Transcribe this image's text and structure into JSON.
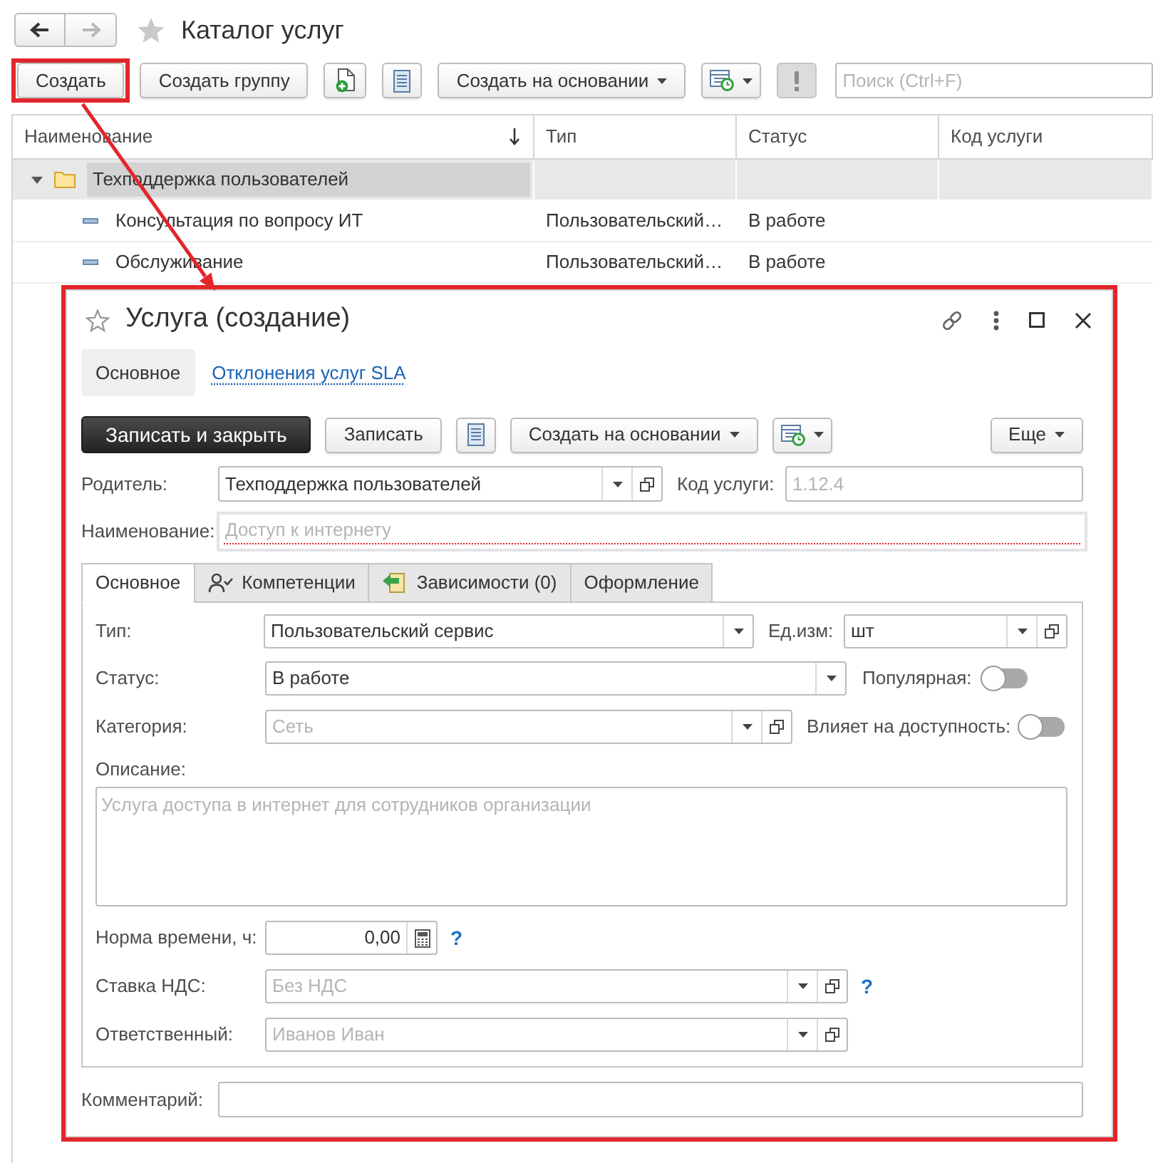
{
  "nav": [
    {
      "kind": "back",
      "disabled": false
    },
    {
      "kind": "forward",
      "disabled": true
    }
  ],
  "window": {
    "title": "Каталог услуг"
  },
  "toolbar": [
    {
      "kind": "button",
      "label": "Создать",
      "highlighted": true
    },
    {
      "kind": "button",
      "label": "Создать группу",
      "highlighted": false
    },
    {
      "kind": "add_document",
      "highlighted": false
    },
    {
      "kind": "list",
      "highlighted": false
    },
    {
      "kind": "menu",
      "label": "Создать на основании",
      "highlighted": false
    },
    {
      "kind": "report_menu",
      "highlighted": false
    },
    {
      "kind": "important",
      "highlighted": false
    }
  ],
  "search": {
    "placeholder": "Поиск (Ctrl+F)"
  },
  "table": {
    "columns": [
      {
        "label": "Наименование",
        "sorted": true
      },
      {
        "label": "Тип",
        "sorted": false
      },
      {
        "label": "Статус",
        "sorted": false
      },
      {
        "label": "Код услуги",
        "sorted": false
      }
    ],
    "rows": [
      {
        "kind": "group",
        "name": "Техподдержка пользователей",
        "expanded": true,
        "selected": true,
        "children": [
          {
            "kind": "item",
            "name": "Консультация по вопросу ИТ",
            "type": "Пользовательский…",
            "status": "В работе",
            "selected": false
          },
          {
            "kind": "item",
            "name": "Обслуживание",
            "type": "Пользовательский…",
            "status": "В работе",
            "selected": false
          }
        ]
      }
    ]
  },
  "form": {
    "highlighted": true,
    "title": "Услуга (создание)",
    "nav_tabs": [
      {
        "label": "Основное",
        "selected": true
      },
      {
        "label": "Отклонения услуг SLA",
        "selected": false
      }
    ],
    "commands": [
      {
        "kind": "primary",
        "label": "Записать и закрыть"
      },
      {
        "kind": "button",
        "label": "Записать"
      },
      {
        "kind": "list"
      },
      {
        "kind": "menu",
        "label": "Создать на основании"
      },
      {
        "kind": "report_menu"
      },
      {
        "kind": "more",
        "label": "Еще"
      }
    ],
    "parent": {
      "label": "Родитель:",
      "value": "Техподдержка пользователей"
    },
    "code": {
      "label": "Код услуги:",
      "placeholder": "1.12.4"
    },
    "name": {
      "label": "Наименование:",
      "placeholder": "Доступ к интернету",
      "required": true
    },
    "tabs": [
      {
        "label": "Основное",
        "selected": true
      },
      {
        "label": "Компетенции",
        "selected": false
      },
      {
        "label": "Зависимости (0)",
        "selected": false
      },
      {
        "label": "Оформление",
        "selected": false
      }
    ],
    "main_tab": {
      "type": {
        "label": "Тип:",
        "value": "Пользовательский сервис"
      },
      "unit": {
        "label": "Ед.изм:",
        "value": "шт"
      },
      "status": {
        "label": "Статус:",
        "value": "В работе"
      },
      "popular": {
        "label": "Популярная:",
        "on": false
      },
      "category": {
        "label": "Категория:",
        "placeholder": "Сеть"
      },
      "affects_availability": {
        "label": "Влияет на доступность:",
        "on": false
      },
      "description": {
        "label": "Описание:",
        "placeholder": "Услуга доступа в интернет для сотрудников организации"
      },
      "time_norm": {
        "label": "Норма времени, ч:",
        "value": "0,00",
        "help": "?"
      },
      "vat_rate": {
        "label": "Ставка НДС:",
        "placeholder": "Без НДС",
        "help": "?"
      },
      "responsible": {
        "label": "Ответственный:",
        "placeholder": "Иванов Иван"
      }
    },
    "comment": {
      "label": "Комментарий:"
    }
  }
}
